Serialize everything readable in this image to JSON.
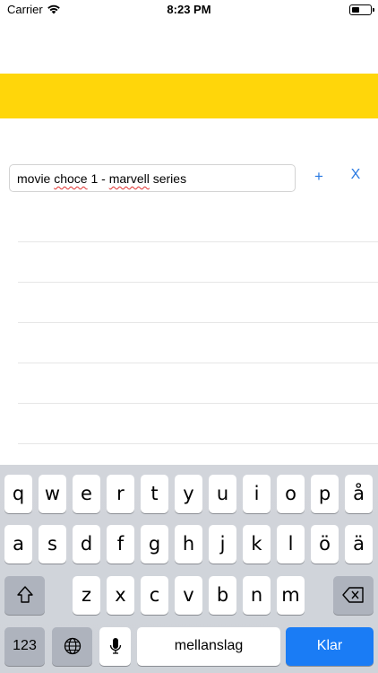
{
  "status_bar": {
    "carrier": "Carrier",
    "time": "8:23 PM",
    "battery_level": 0.4
  },
  "header": {
    "bar_color": "#FFD60A"
  },
  "entry": {
    "text_before": "movie ",
    "text_misspelled_1": "choce",
    "text_middle": " 1 - ",
    "text_misspelled_2": "marvell",
    "text_after": " series",
    "add_label": "+",
    "clear_label": "X",
    "button_color": "#2a7ae2"
  },
  "list": {
    "rows": [
      "",
      "",
      "",
      "",
      "",
      ""
    ]
  },
  "keyboard": {
    "row1": [
      "q",
      "w",
      "e",
      "r",
      "t",
      "y",
      "u",
      "i",
      "o",
      "p",
      "å"
    ],
    "row2": [
      "a",
      "s",
      "d",
      "f",
      "g",
      "h",
      "j",
      "k",
      "l",
      "ö",
      "ä"
    ],
    "row3": [
      "z",
      "x",
      "c",
      "v",
      "b",
      "n",
      "m"
    ],
    "numbers_label": "123",
    "space_label": "mellanslag",
    "return_label": "Klar",
    "icons": {
      "shift": "shift-icon",
      "backspace": "backspace-icon",
      "globe": "globe-icon",
      "mic": "microphone-icon"
    }
  }
}
